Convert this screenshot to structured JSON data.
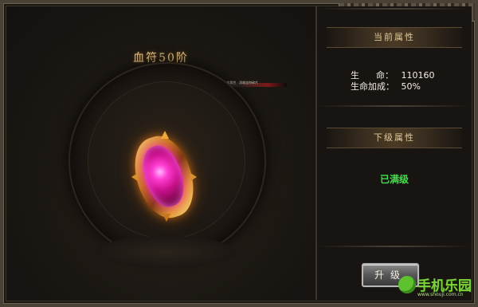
{
  "panel": {
    "title": "血符50阶",
    "info_line": "1 · 血符进阶后提升生命属性 · 消耗血符碎片"
  },
  "current_attributes": {
    "header": "当前属性",
    "stats": [
      {
        "label": "生      命：",
        "value": "110160"
      },
      {
        "label": "生命加成：",
        "value": "50%"
      }
    ]
  },
  "next_attributes": {
    "header": "下级属性",
    "status": "已满级"
  },
  "buttons": {
    "upgrade": "升级"
  },
  "watermark": {
    "name": "手机乐园",
    "url": "www.shouji.com.cn"
  },
  "colors": {
    "gold_text": "#e8c78a",
    "maxed_green": "#3fe04a",
    "gem_pink": "#ff3dd2"
  }
}
